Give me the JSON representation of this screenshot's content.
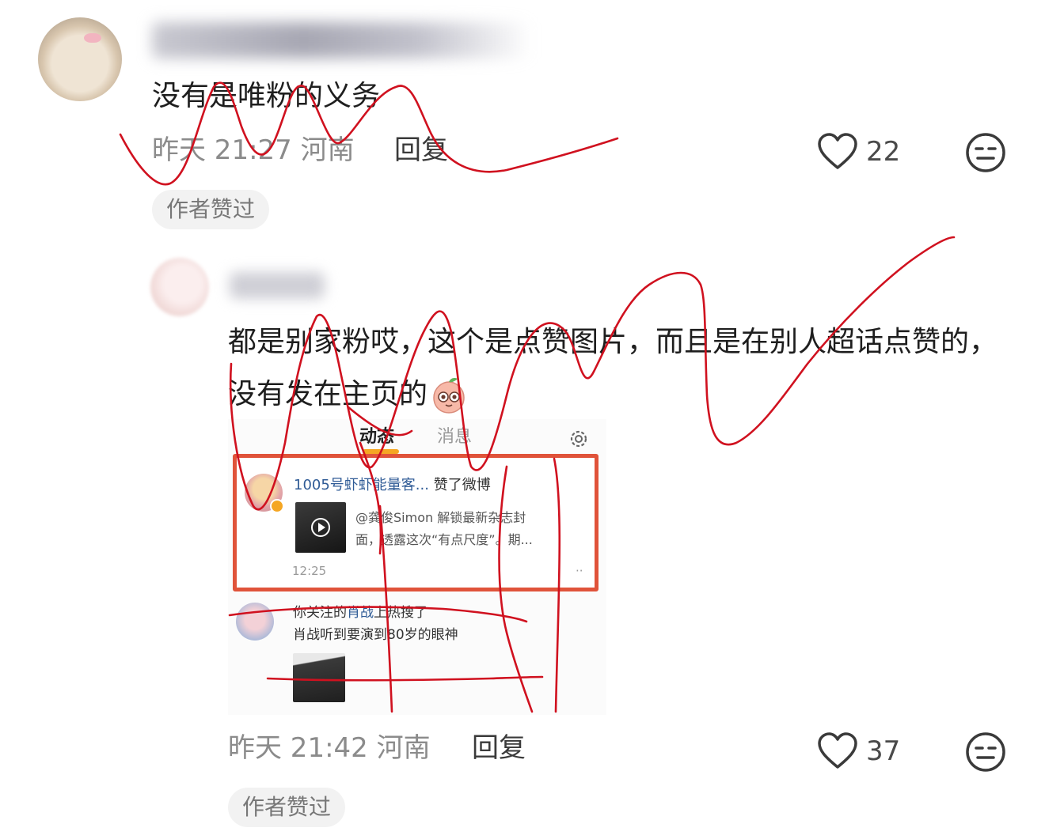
{
  "comments": [
    {
      "text": "没有是唯粉的义务",
      "time": "昨天 21:27",
      "location": "河南",
      "reply_label": "回复",
      "likes": "22",
      "badge": "作者赞过"
    },
    {
      "text": "都是别家粉哎，这个是点赞图片，而且是在别人超话点赞的，没有发在主页的",
      "time": "昨天 21:42",
      "location": "河南",
      "reply_label": "回复",
      "likes": "37",
      "badge": "作者赞过",
      "embedded_screenshot": {
        "tabs": [
          "动态",
          "消息"
        ],
        "item1": {
          "user": "1005号虾虾能量客...",
          "action": "赞了微博",
          "desc_line1": "@龚俊Simon 解锁最新杂志封",
          "desc_line2": "面，透露这次“有点尺度”。期...",
          "time": "12:25",
          "more": "··"
        },
        "item2": {
          "line1_prefix": "你关注的",
          "line1_link": "肖战",
          "line1_suffix": "上热搜了",
          "line2": "肖战听到要演到80岁的眼神"
        }
      }
    }
  ],
  "icons": {
    "like": "heart-outline-icon",
    "dislike": "meh-face-icon",
    "settings": "gear-icon",
    "emoji": "peach-emoji-icon"
  },
  "colors": {
    "scribble": "#d0111f",
    "highlight_box": "#e0533a",
    "meta_text": "#8b8b8b"
  }
}
